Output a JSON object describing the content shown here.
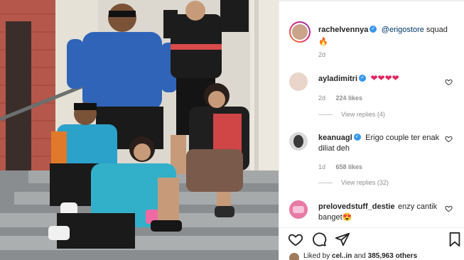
{
  "post": {
    "author": "rachelvennya",
    "caption_mention": "@erigostore",
    "caption_text": " squad",
    "caption_emoji": "🔥",
    "age": "2d"
  },
  "comments": [
    {
      "user": "ayladimitri",
      "text": "❤❤❤❤",
      "age": "2d",
      "likes": "224 likes",
      "replies": "View replies (4)",
      "avatar_color": "#e9d5c9"
    },
    {
      "user": "keanuagl",
      "text": "Erigo couple ter enak diliat deh",
      "age": "1d",
      "likes": "658 likes",
      "replies": "View replies (32)",
      "avatar_color": "#3a3a3a"
    },
    {
      "user": "prelovedstuff_destie",
      "text": "enzy cantik banget😍",
      "avatar_color": "#e87aa6"
    }
  ],
  "footer": {
    "liked_prefix": "Liked by",
    "liked_user": "cel..in",
    "liked_and": "and",
    "liked_count": "385,963 others"
  },
  "colors": {
    "verified": "#3897f0",
    "mention": "#00376b",
    "meta": "#8e8e8e"
  }
}
